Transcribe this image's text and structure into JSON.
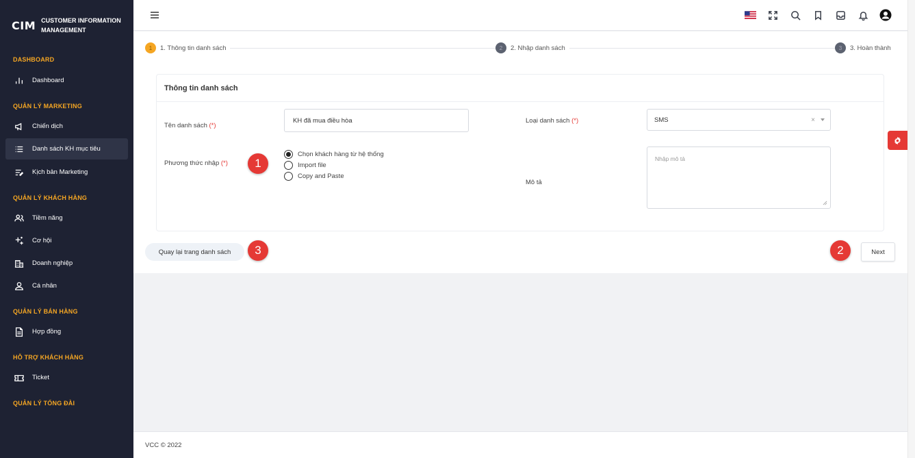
{
  "brand": {
    "logo": "CIM",
    "name": "CUSTOMER INFORMATION MANAGEMENT"
  },
  "sidebar": {
    "sections": [
      {
        "title": "DASHBOARD",
        "items": [
          {
            "label": "Dashboard",
            "icon": "bar-chart-icon",
            "active": false
          }
        ]
      },
      {
        "title": "QUẢN LÝ MARKETING",
        "items": [
          {
            "label": "Chiến dịch",
            "icon": "megaphone-icon",
            "active": false
          },
          {
            "label": "Danh sách KH mục tiêu",
            "icon": "list-icon",
            "active": true
          },
          {
            "label": "Kịch bản Marketing",
            "icon": "script-icon",
            "active": false
          }
        ]
      },
      {
        "title": "QUẢN LÝ KHÁCH HÀNG",
        "items": [
          {
            "label": "Tiềm năng",
            "icon": "users-icon",
            "active": false
          },
          {
            "label": "Cơ hội",
            "icon": "sparkle-icon",
            "active": false
          },
          {
            "label": "Doanh nghiệp",
            "icon": "building-icon",
            "active": false
          },
          {
            "label": "Cá nhân",
            "icon": "user-icon",
            "active": false
          }
        ]
      },
      {
        "title": "QUẢN LÝ BÁN HÀNG",
        "items": [
          {
            "label": "Hợp đồng",
            "icon": "document-icon",
            "active": false
          }
        ]
      },
      {
        "title": "HỖ TRỢ KHÁCH HÀNG",
        "items": [
          {
            "label": "Ticket",
            "icon": "ticket-icon",
            "active": false
          }
        ]
      },
      {
        "title": "QUẢN LÝ TỔNG ĐÀI",
        "items": []
      }
    ]
  },
  "topbar": {
    "icons": [
      "us-flag-icon",
      "fullscreen-icon",
      "search-icon",
      "bookmark-icon",
      "inbox-icon",
      "bell-icon",
      "account-icon"
    ]
  },
  "steps": [
    {
      "number": "1",
      "label": "1. Thông tin danh sách",
      "active": true
    },
    {
      "number": "2",
      "label": "2. Nhập danh sách",
      "active": false
    },
    {
      "number": "3",
      "label": "3. Hoàn thành",
      "active": false
    }
  ],
  "form": {
    "card_title": "Thông tin danh sách",
    "list_name_label": "Tên danh sách",
    "list_name_value": "KH đã mua điều hòa",
    "list_type_label": "Loại danh sách",
    "list_type_value": "SMS",
    "required_mark": "(*)",
    "import_method_label": "Phương thức nhập",
    "import_options": [
      {
        "label": "Chọn khách hàng từ hệ thống",
        "checked": true
      },
      {
        "label": "Import file",
        "checked": false
      },
      {
        "label": "Copy and Paste",
        "checked": false
      }
    ],
    "description_label": "Mô tả",
    "description_placeholder": "Nhập mô tả"
  },
  "badges": [
    "1",
    "2",
    "3"
  ],
  "buttons": {
    "back": "Quay lại trang danh sách",
    "next": "Next"
  },
  "footer": {
    "text": "VCC © 2022"
  },
  "colors": {
    "sidebar_bg": "#1e2233",
    "accent": "#f5a623",
    "danger": "#e53935"
  }
}
